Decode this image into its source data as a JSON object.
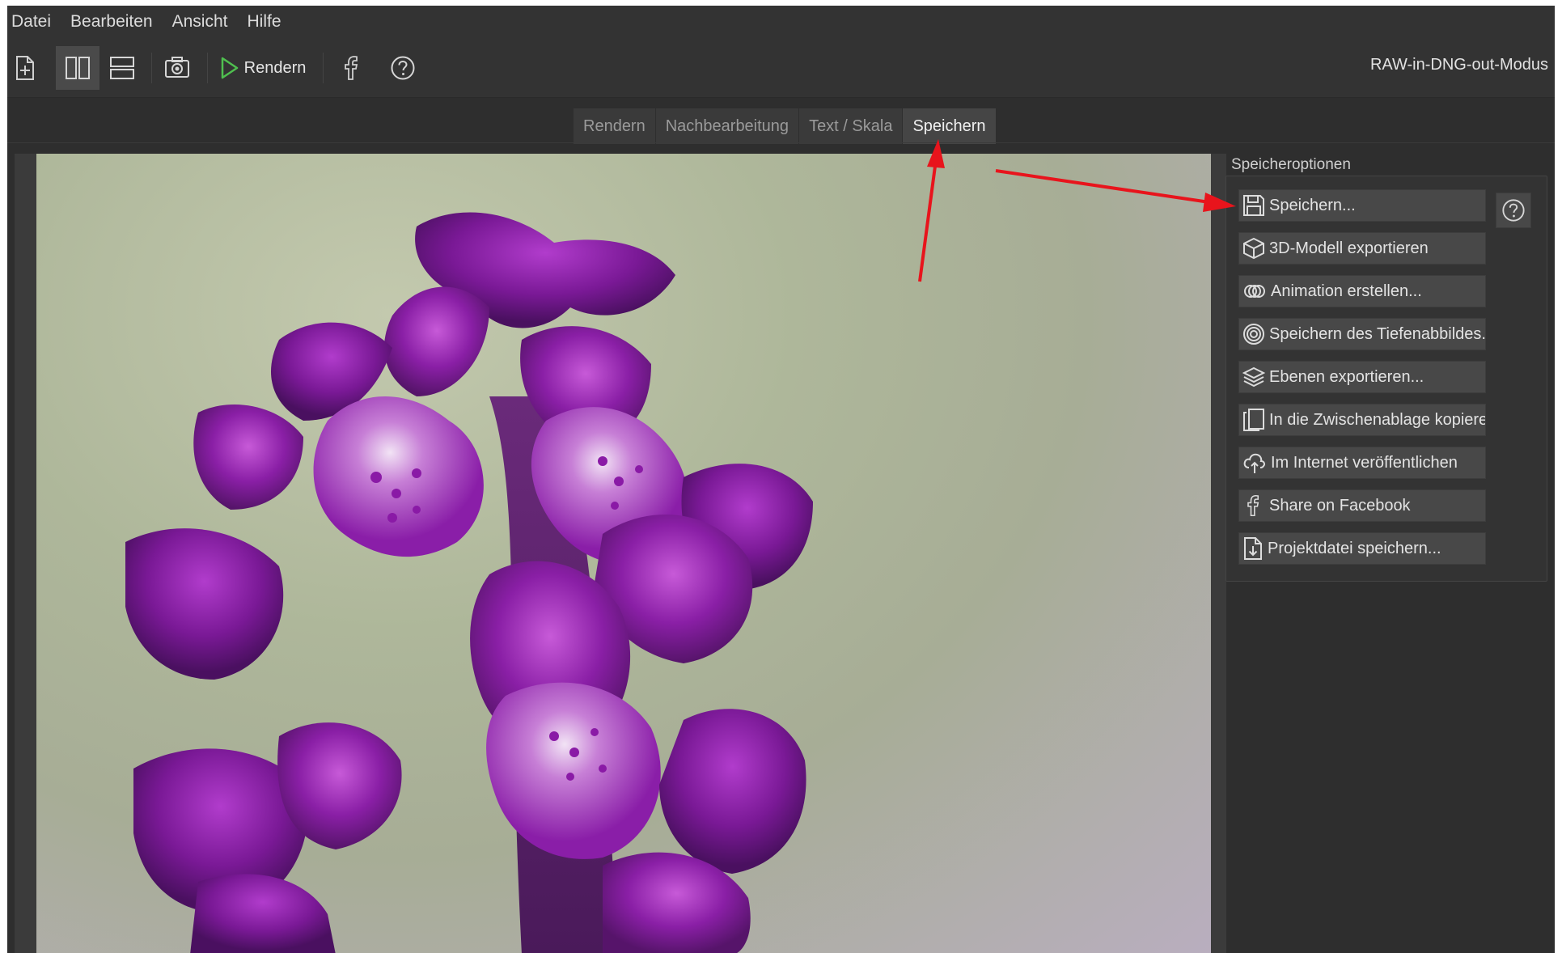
{
  "menu": {
    "items": [
      "Datei",
      "Bearbeiten",
      "Ansicht",
      "Hilfe"
    ]
  },
  "toolbar": {
    "render_label": "Rendern",
    "mode_label": "RAW-in-DNG-out-Modus",
    "icons": [
      "new-file-icon",
      "split-vertical-icon",
      "split-horizontal-icon",
      "screenshot-icon",
      "play-icon",
      "facebook-icon",
      "help-icon"
    ]
  },
  "tabs": {
    "items": [
      "Rendern",
      "Nachbearbeitung",
      "Text / Skala",
      "Speichern"
    ],
    "active": "Speichern"
  },
  "panel": {
    "title": "Speicheroptionen",
    "buttons": [
      {
        "label": "Speichern...",
        "icon": "floppy-disk-icon"
      },
      {
        "label": "3D-Modell exportieren",
        "icon": "cube-icon"
      },
      {
        "label": "Animation erstellen...",
        "icon": "animation-icon"
      },
      {
        "label": "Speichern des Tiefenabbildes..",
        "icon": "depth-map-icon"
      },
      {
        "label": "Ebenen exportieren...",
        "icon": "layers-icon"
      },
      {
        "label": "In die Zwischenablage kopieren",
        "icon": "clipboard-icon"
      },
      {
        "label": "Im Internet veröffentlichen",
        "icon": "cloud-upload-icon"
      },
      {
        "label": "Share on Facebook",
        "icon": "facebook-icon"
      },
      {
        "label": "Projektdatei speichern...",
        "icon": "project-file-icon"
      }
    ]
  },
  "colors": {
    "background": "#2e2e2e",
    "button": "#484848",
    "accent_green": "#4fbf4f",
    "annotation_red": "#e8141c"
  }
}
